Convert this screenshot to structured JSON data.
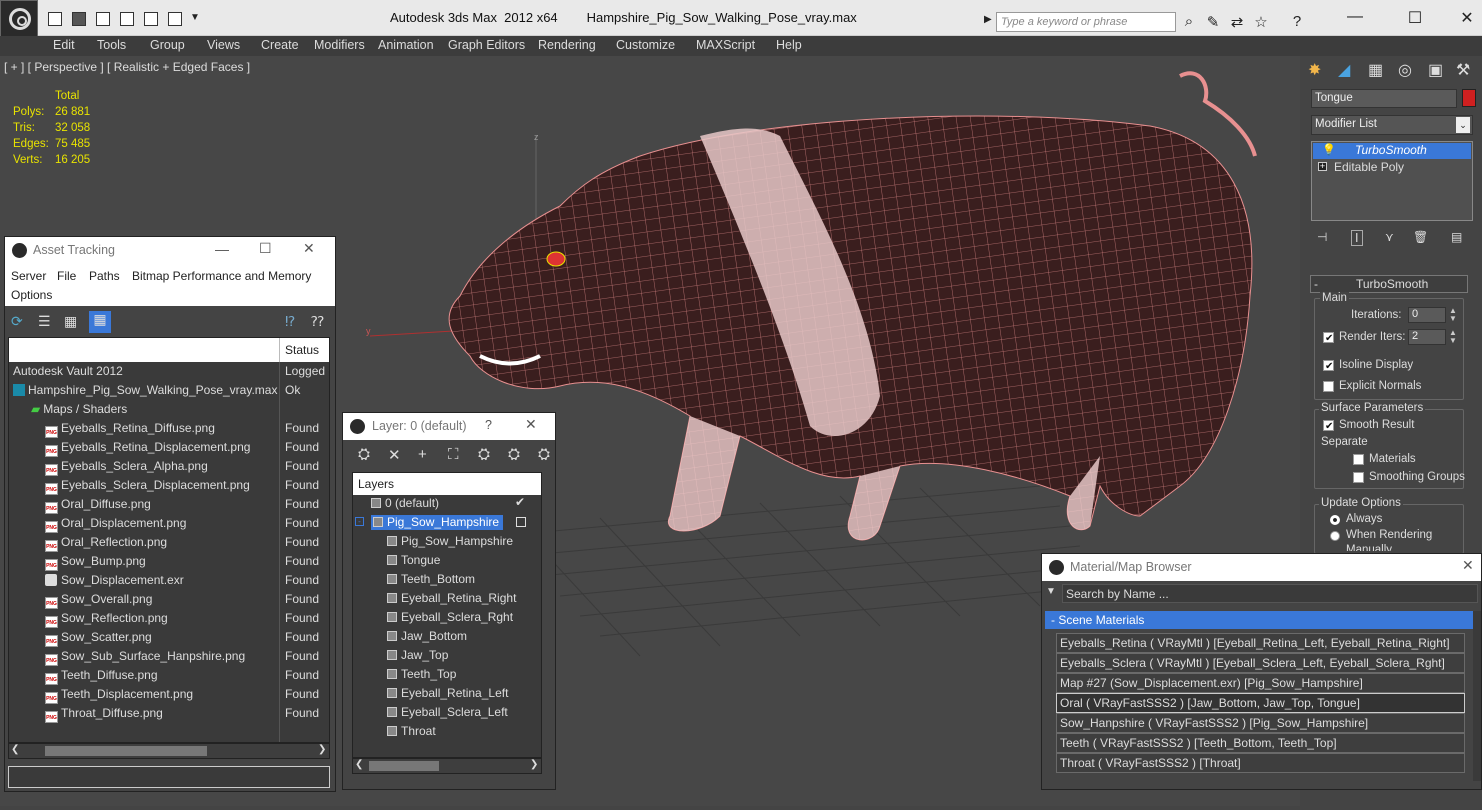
{
  "app": {
    "title": "Autodesk 3ds Max  2012 x64",
    "file": "Hampshire_Pig_Sow_Walking_Pose_vray.max",
    "search_placeholder": "Type a keyword or phrase"
  },
  "menu": [
    "Edit",
    "Tools",
    "Group",
    "Views",
    "Create",
    "Modifiers",
    "Animation",
    "Graph Editors",
    "Rendering",
    "Customize",
    "MAXScript",
    "Help"
  ],
  "viewport": {
    "label": "[ + ] [ Perspective ] [ Realistic + Edged Faces ]",
    "stats": {
      "header": "Total",
      "rows": [
        {
          "k": "Polys:",
          "v": "26 881"
        },
        {
          "k": "Tris:",
          "v": "32 058"
        },
        {
          "k": "Edges:",
          "v": "75 485"
        },
        {
          "k": "Verts:",
          "v": "16 205"
        }
      ]
    },
    "axis_z": "z",
    "axis_y": "y"
  },
  "command_panel": {
    "object_name": "Tongue",
    "modifier_list": "Modifier List",
    "stack": [
      "TurboSmooth",
      "Editable Poly"
    ],
    "rollout_title": "TurboSmooth",
    "main_label": "Main",
    "iterations_label": "Iterations:",
    "iterations_value": "0",
    "render_iters_label": "Render Iters:",
    "render_iters_value": "2",
    "isoline": "Isoline Display",
    "explicit": "Explicit Normals",
    "surface_label": "Surface Parameters",
    "smooth_result": "Smooth Result",
    "separate": "Separate",
    "materials": "Materials",
    "smoothing": "Smoothing Groups",
    "update_label": "Update Options",
    "always": "Always",
    "when_rendering": "When Rendering",
    "manually": "Manually"
  },
  "asset_tracking": {
    "title": "Asset Tracking",
    "menu": [
      "Server",
      "File",
      "Paths",
      "Bitmap Performance and Memory",
      "Options"
    ],
    "col_status": "Status",
    "rows": [
      {
        "name": "Autodesk Vault 2012",
        "status": "Logged Out"
      },
      {
        "name": "Hampshire_Pig_Sow_Walking_Pose_vray.max",
        "status": "Ok"
      },
      {
        "name": "Maps / Shaders",
        "status": ""
      },
      {
        "name": "Eyeballs_Retina_Diffuse.png",
        "status": "Found"
      },
      {
        "name": "Eyeballs_Retina_Displacement.png",
        "status": "Found"
      },
      {
        "name": "Eyeballs_Sclera_Alpha.png",
        "status": "Found"
      },
      {
        "name": "Eyeballs_Sclera_Displacement.png",
        "status": "Found"
      },
      {
        "name": "Oral_Diffuse.png",
        "status": "Found"
      },
      {
        "name": "Oral_Displacement.png",
        "status": "Found"
      },
      {
        "name": "Oral_Reflection.png",
        "status": "Found"
      },
      {
        "name": "Sow_Bump.png",
        "status": "Found"
      },
      {
        "name": "Sow_Displacement.exr",
        "status": "Found"
      },
      {
        "name": "Sow_Overall.png",
        "status": "Found"
      },
      {
        "name": "Sow_Reflection.png",
        "status": "Found"
      },
      {
        "name": "Sow_Scatter.png",
        "status": "Found"
      },
      {
        "name": "Sow_Sub_Surface_Hanpshire.png",
        "status": "Found"
      },
      {
        "name": "Teeth_Diffuse.png",
        "status": "Found"
      },
      {
        "name": "Teeth_Displacement.png",
        "status": "Found"
      },
      {
        "name": "Throat_Diffuse.png",
        "status": "Found"
      }
    ]
  },
  "layers": {
    "title": "Layer: 0 (default)",
    "help": "?",
    "header": "Layers",
    "rows": [
      "0 (default)",
      "Pig_Sow_Hampshire",
      "Pig_Sow_Hampshire",
      "Tongue",
      "Teeth_Bottom",
      "Eyeball_Retina_Right",
      "Eyeball_Sclera_Rght",
      "Jaw_Bottom",
      "Jaw_Top",
      "Teeth_Top",
      "Eyeball_Retina_Left",
      "Eyeball_Sclera_Left",
      "Throat"
    ]
  },
  "material_browser": {
    "title": "Material/Map Browser",
    "search": "Search by Name ...",
    "group": "- Scene Materials",
    "rows": [
      "Eyeballs_Retina  ( VRayMtl ) [Eyeball_Retina_Left, Eyeball_Retina_Right]",
      "Eyeballs_Sclera  ( VRayMtl ) [Eyeball_Sclera_Left, Eyeball_Sclera_Rght]",
      "Map #27 (Sow_Displacement.exr)  [Pig_Sow_Hampshire]",
      "Oral  ( VRayFastSSS2 ) [Jaw_Bottom, Jaw_Top, Tongue]",
      "Sow_Hanpshire  ( VRayFastSSS2 ) [Pig_Sow_Hampshire]",
      "Teeth  ( VRayFastSSS2 ) [Teeth_Bottom, Teeth_Top]",
      "Throat  ( VRayFastSSS2 ) [Throat]"
    ]
  },
  "colors": {
    "accent": "#3a78d8",
    "stats": "#e8e300",
    "wire": "#e89090"
  }
}
